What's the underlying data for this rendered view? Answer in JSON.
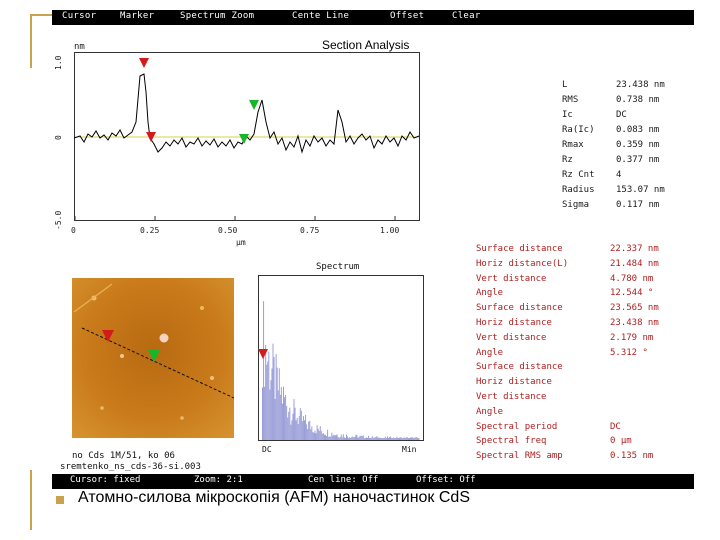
{
  "menu": [
    "Cursor",
    "Marker",
    "Spectrum Zoom",
    "Cente Line",
    "Offset",
    "Clear"
  ],
  "section": {
    "title": "Section Analysis",
    "y_unit": "nm",
    "x_unit": "μm",
    "y_ticks": [
      "1.0",
      "0",
      "-5.0"
    ],
    "x_ticks": [
      "0",
      "0.25",
      "0.50",
      "0.75",
      "1.00"
    ]
  },
  "section_stats": {
    "labels": [
      "L",
      "RMS",
      "Ic",
      "Ra(Ic)",
      "Rmax",
      "Rz",
      "Rz Cnt",
      "Radius",
      "Sigma"
    ],
    "values": [
      "23.438 nm",
      "0.738 nm",
      "DC",
      "0.083 nm",
      "0.359 nm",
      "0.377 nm",
      "4",
      "153.07 nm",
      "0.117 nm"
    ]
  },
  "spectrum": {
    "title": "Spectrum",
    "x_left": "DC",
    "x_right": "Min"
  },
  "image_caption": {
    "line1": "no Cds 1M/51, ko 06",
    "line2": "sremtenko_ns_cds-36-si.003"
  },
  "measurements": [
    {
      "label": "Surface distance",
      "value": "22.337 nm"
    },
    {
      "label": "Horiz distance(L)",
      "value": "21.484 nm"
    },
    {
      "label": "Vert distance",
      "value": "4.780 nm"
    },
    {
      "label": "Angle",
      "value": "12.544 °"
    },
    {
      "label": "Surface distance",
      "value": "23.565 nm"
    },
    {
      "label": "Horiz distance",
      "value": "23.438 nm"
    },
    {
      "label": "Vert distance",
      "value": "2.179 nm"
    },
    {
      "label": "Angle",
      "value": "5.312 °"
    },
    {
      "label": "Surface distance",
      "value": ""
    },
    {
      "label": "Horiz distance",
      "value": ""
    },
    {
      "label": "Vert distance",
      "value": ""
    },
    {
      "label": "Angle",
      "value": ""
    },
    {
      "label": "Spectral period",
      "value": "DC"
    },
    {
      "label": "Spectral freq",
      "value": "0 µm"
    },
    {
      "label": "Spectral RMS amp",
      "value": "0.135 nm"
    }
  ],
  "status": [
    "Cursor: fixed",
    "Zoom: 2:1",
    "Cen line: Off",
    "Offset: Off"
  ],
  "caption": "Атомно-силова мікроскопія (AFM) наночастинок CdS",
  "colors": {
    "accent_gold": "#c9a24a",
    "marker_red": "#d21b1b",
    "marker_green": "#19b52a",
    "spectrum_bar": "#9b9fd8",
    "measure_text": "#b02020"
  }
}
